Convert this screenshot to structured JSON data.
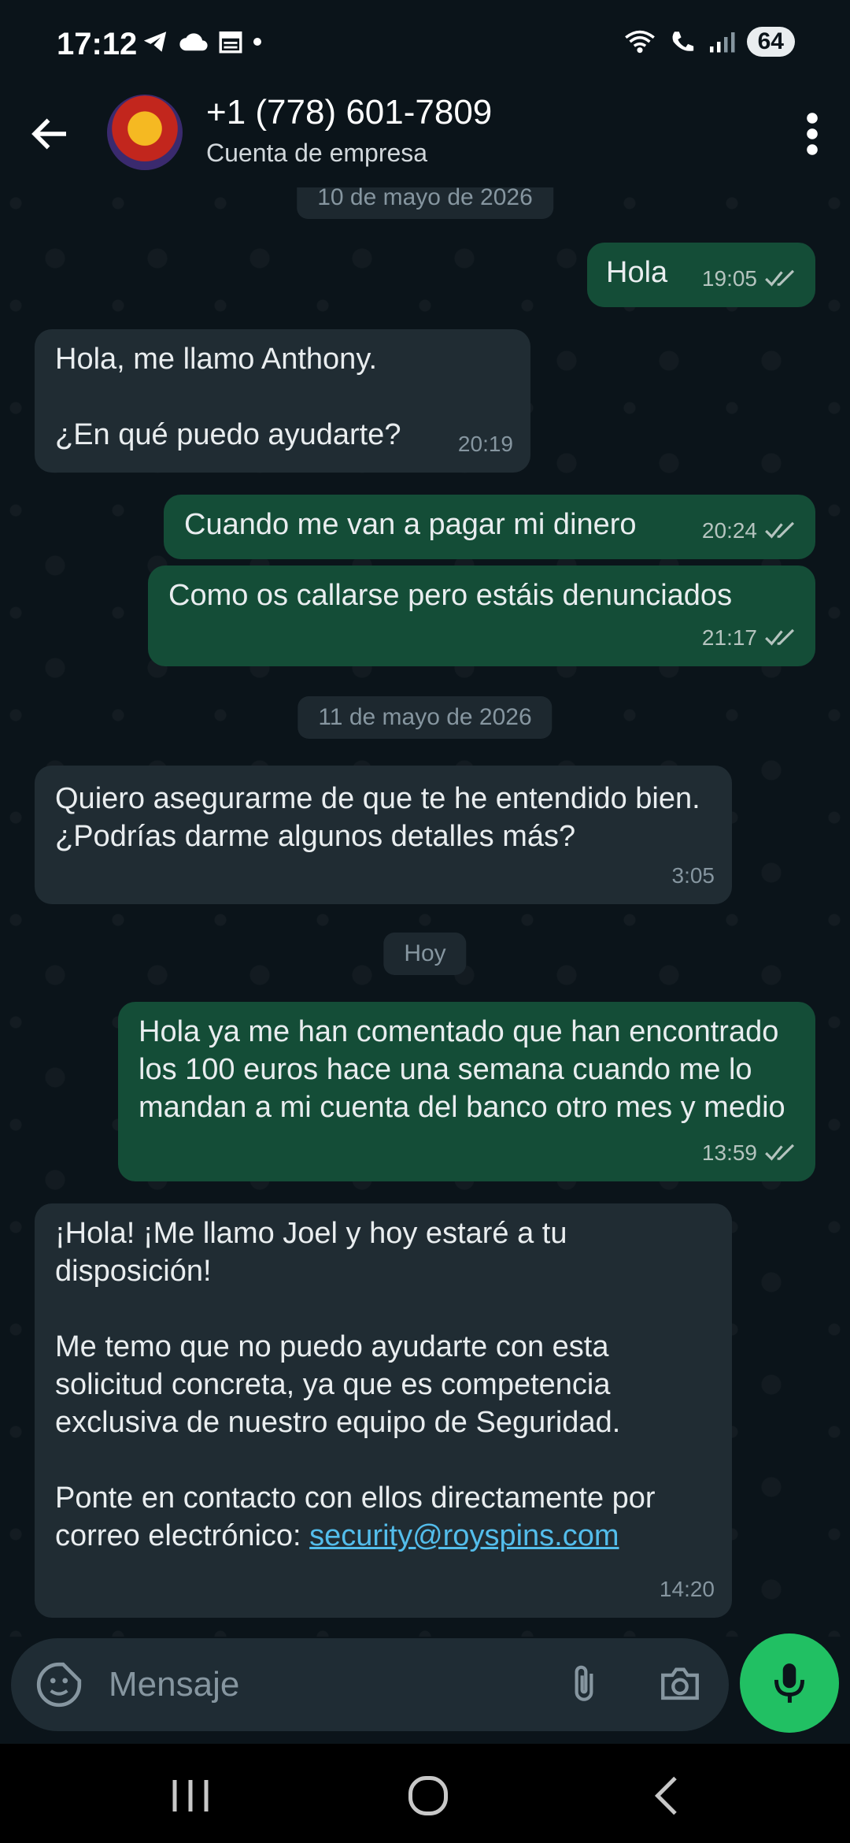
{
  "status": {
    "time": "17:12",
    "battery": "64"
  },
  "header": {
    "title": "+1 (778) 601-7809",
    "subtitle": "Cuenta de empresa"
  },
  "chat": {
    "date_top": "10 de mayo de 2026",
    "date_mid": "11 de mayo de 2026",
    "date_today": "Hoy",
    "messages": [
      {
        "direction": "out",
        "text": "Hola",
        "time": "19:05"
      },
      {
        "direction": "in",
        "text_line1": "Hola, me llamo Anthony.",
        "text_line2": "¿En qué puedo ayudarte?",
        "time": "20:19"
      },
      {
        "direction": "out",
        "text": "Cuando me van a pagar mi dinero",
        "time": "20:24"
      },
      {
        "direction": "out",
        "text": "Como os callarse pero estáis denunciados",
        "time": "21:17"
      },
      {
        "direction": "in",
        "text": "Quiero asegurarme de que te he entendido bien. ¿Podrías darme algunos detalles más?",
        "time": "3:05"
      },
      {
        "direction": "out",
        "text": "Hola ya me han comentado que han encontrado los 100 euros hace una semana cuando me lo mandan a mi cuenta del banco otro mes y medio",
        "time": "13:59"
      },
      {
        "direction": "in",
        "para1": "¡Hola! ¡Me llamo Joel y hoy estaré a tu disposición!",
        "para2": "Me temo que no puedo ayudarte con esta solicitud concreta, ya que es competencia exclusiva de nuestro equipo de Seguridad.",
        "para3": "Ponte en contacto con ellos directamente por correo electrónico: ",
        "link": "security@royspins.com",
        "time": "14:20"
      }
    ]
  },
  "input": {
    "placeholder": "Mensaje"
  },
  "colors": {
    "outgoing": "#144d37",
    "incoming": "#202c33",
    "accent": "#21c063",
    "link": "#53bdeb"
  },
  "icons": [
    "telegram-icon",
    "cloud-icon",
    "calendar-icon",
    "wifi-call-icon",
    "phone-icon",
    "signal-icon",
    "back-arrow-icon",
    "more-vert-icon",
    "sticker-icon",
    "attach-icon",
    "camera-icon",
    "mic-icon",
    "recents-icon",
    "home-icon",
    "nav-back-icon"
  ]
}
